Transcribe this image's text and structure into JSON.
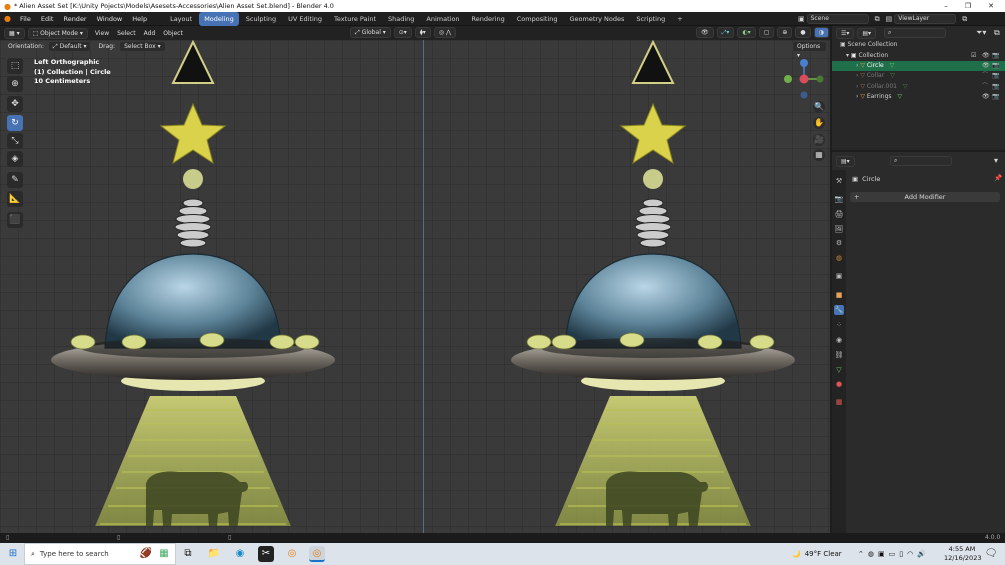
{
  "window": {
    "title": "* Alien Asset Set [K:\\Unity Pojects\\Models\\Asesets-Accessories\\Alien Asset Set.blend] - Blender 4.0",
    "minimize": "–",
    "maximize": "❐",
    "close": "✕"
  },
  "menubar": {
    "items": [
      "File",
      "Edit",
      "Render",
      "Window",
      "Help"
    ],
    "workspaces": [
      "Layout",
      "Modeling",
      "Sculpting",
      "UV Editing",
      "Texture Paint",
      "Shading",
      "Animation",
      "Rendering",
      "Compositing",
      "Geometry Nodes",
      "Scripting"
    ],
    "active_workspace": "Modeling",
    "add_tab": "+",
    "scene": "Scene",
    "view_layer": "ViewLayer"
  },
  "viewport_header": {
    "mode": "Object Mode",
    "menus": [
      "View",
      "Select",
      "Add",
      "Object"
    ],
    "transform_orientation": "Global",
    "orientation_label": "Orientation:",
    "orientation_value": "Default",
    "drag_label": "Drag:",
    "drag_value": "Select Box",
    "options": "Options"
  },
  "viewport": {
    "info_lines": [
      "Left Orthographic",
      "(1) Collection | Circle",
      "10 Centimeters"
    ],
    "gizmo_labels": {
      "z": "Z",
      "y": "Y"
    }
  },
  "toolbar": {
    "tools": [
      "select-box",
      "cursor",
      "move",
      "rotate",
      "scale",
      "transform",
      "annotate",
      "measure",
      "add-cube"
    ],
    "active_tool": "rotate"
  },
  "outliner": {
    "search_placeholder": "",
    "scene_collection": "Scene Collection",
    "collection": "Collection",
    "objects": [
      {
        "name": "Circle",
        "selected": true,
        "visible": true
      },
      {
        "name": "Collar",
        "selected": false,
        "visible": false
      },
      {
        "name": "Collar.001",
        "selected": false,
        "visible": false
      },
      {
        "name": "Earrings",
        "selected": false,
        "visible": true
      }
    ]
  },
  "properties": {
    "search_placeholder": "",
    "object_name": "Circle",
    "add_modifier": "Add Modifier"
  },
  "statusbar": {
    "version": "4.0.0"
  },
  "taskbar": {
    "search_placeholder": "Type here to search",
    "weather": "49°F  Clear",
    "time": "4:55 AM",
    "date": "12/16/2023"
  },
  "colors": {
    "accent": "#4772b3",
    "selected_row": "#1f6f4a",
    "grid": "#3a3a3a",
    "object_orange": "#e8a25a",
    "star_yellow": "#d9d24a",
    "beam": "#c8cc6a"
  }
}
